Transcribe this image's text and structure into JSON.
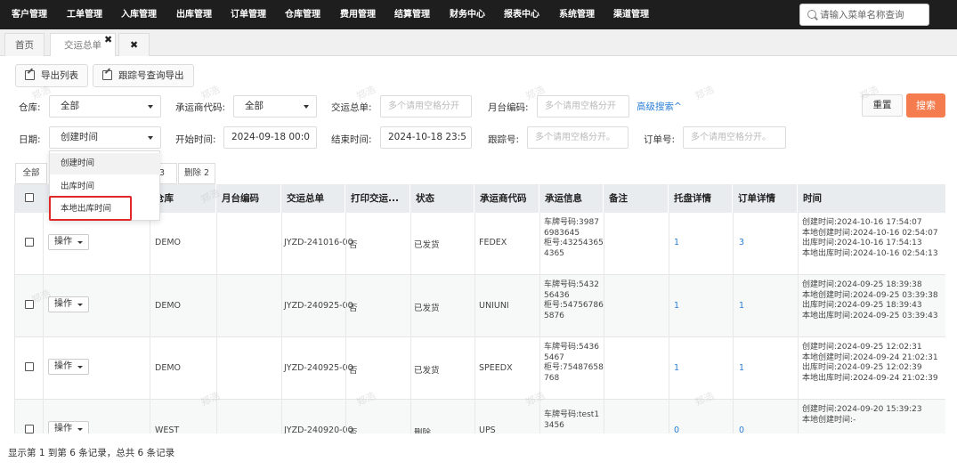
{
  "nav": {
    "items": [
      "客户管理",
      "工单管理",
      "入库管理",
      "出库管理",
      "订单管理",
      "仓库管理",
      "费用管理",
      "结算管理",
      "财务中心",
      "报表中心",
      "系统管理",
      "渠道管理"
    ],
    "search_placeholder": "请输入菜单名称查询"
  },
  "tabs": {
    "home": "首页",
    "current": "交运总单",
    "close": "✖",
    "close_all": "✖"
  },
  "toolbar": {
    "export_list": "导出列表",
    "export_tracking": "跟踪号查询导出"
  },
  "filters": {
    "warehouse_label": "仓库:",
    "warehouse_value": "全部",
    "carrier_label": "承运商代码:",
    "carrier_value": "全部",
    "master_label": "交运总单:",
    "master_placeholder": "多个请用空格分开",
    "platform_label": "月台编码:",
    "platform_placeholder": "多个请用空格分开",
    "advanced": "高级搜索^",
    "reset": "重置",
    "search": "搜索",
    "date_label": "日期:",
    "date_value": "创建时间",
    "start_label": "开始时间:",
    "start_value": "2024-09-18 00:0",
    "end_label": "结束时间:",
    "end_value": "2024-10-18 23:5",
    "tracking_label": "跟踪号:",
    "tracking_placeholder": "多个请用空格分开。",
    "order_label": "订单号:",
    "order_placeholder": "多个请用空格分开。"
  },
  "date_dropdown": {
    "options": [
      "创建时间",
      "出库时间",
      "本地出库时间"
    ]
  },
  "subtabs": {
    "all": "全部",
    "partial": "3",
    "deleted": "删除 2"
  },
  "columns": [
    "仓库",
    "月台编码",
    "交运总单",
    "打印交运...",
    "状态",
    "承运商代码",
    "承运信息",
    "备注",
    "托盘详情",
    "订单详情",
    "时间"
  ],
  "rows": [
    {
      "op": "操作",
      "warehouse": "DEMO",
      "master": "JYZD-241016-00",
      "print": "否",
      "status": "已发货",
      "carrier": "FEDEX",
      "info": [
        "车牌号码:3987",
        "6983645",
        "柜号:43254365",
        "4365"
      ],
      "pallet": "1",
      "order": "3",
      "time": [
        "创建时间:2024-10-16 17:54:07",
        "本地创建时间:2024-10-16 02:54:07",
        "出库时间:2024-10-16 17:54:13",
        "本地出库时间:2024-10-16 02:54:13"
      ]
    },
    {
      "op": "操作",
      "warehouse": "DEMO",
      "master": "JYZD-240925-00",
      "print": "否",
      "status": "已发货",
      "carrier": "UNIUNI",
      "info": [
        "车牌号码:5432",
        "56436",
        "柜号:54756786",
        "5876"
      ],
      "pallet": "1",
      "order": "1",
      "time": [
        "创建时间:2024-09-25 18:39:38",
        "本地创建时间:2024-09-25 03:39:38",
        "出库时间:2024-09-25 18:39:43",
        "本地出库时间:2024-09-25 03:39:43"
      ]
    },
    {
      "op": "操作",
      "warehouse": "DEMO",
      "master": "JYZD-240925-00",
      "print": "否",
      "status": "已发货",
      "carrier": "SPEEDX",
      "info": [
        "车牌号码:5436",
        "5467",
        "柜号:75487658",
        "768"
      ],
      "pallet": "1",
      "order": "1",
      "time": [
        "创建时间:2024-09-25 12:02:31",
        "本地创建时间:2024-09-24 21:02:31",
        "出库时间:2024-09-25 12:02:39",
        "本地出库时间:2024-09-24 21:02:39"
      ]
    },
    {
      "op": "操作",
      "warehouse": "WEST",
      "master": "JYZD-240920-00",
      "print": "否",
      "status": "删除",
      "carrier": "UPS",
      "info": [
        "车牌号码:test1",
        "3456"
      ],
      "pallet": "0",
      "order": "0",
      "time": [
        "创建时间:2024-09-20 15:39:23",
        "本地创建时间:-"
      ]
    }
  ],
  "footer": "显示第 1 到第 6 条记录，总共 6 条记录",
  "watermark": "郑浩"
}
